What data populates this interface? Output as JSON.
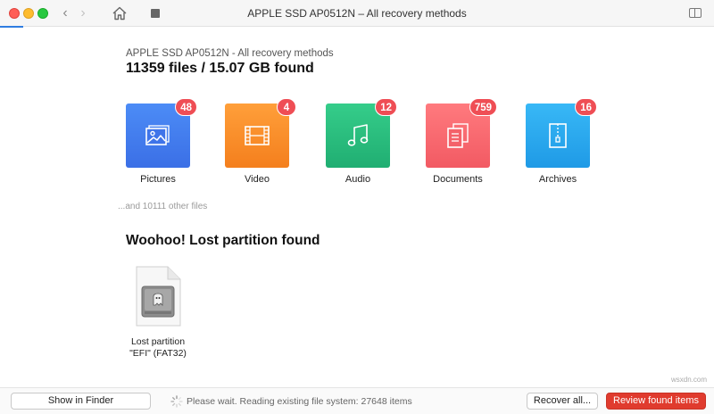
{
  "window": {
    "title": "APPLE SSD AP0512N – All recovery methods"
  },
  "header": {
    "drive_label": "APPLE SSD AP0512N - All recovery methods",
    "summary": "11359 files / 15.07 GB found"
  },
  "categories": [
    {
      "label": "Pictures",
      "count": "48",
      "icon": "picture-icon",
      "color": "#3b6fe6"
    },
    {
      "label": "Video",
      "count": "4",
      "icon": "film-icon",
      "color": "#f47f1d"
    },
    {
      "label": "Audio",
      "count": "12",
      "icon": "music-note-icon",
      "color": "#20ae72"
    },
    {
      "label": "Documents",
      "count": "759",
      "icon": "documents-icon",
      "color": "#f25a63"
    },
    {
      "label": "Archives",
      "count": "16",
      "icon": "archive-zipper-icon",
      "color": "#1f9ae6"
    }
  ],
  "other_files": "...and 10111 other files",
  "partition": {
    "heading": "Woohoo! Lost partition found",
    "name_line1": "Lost partition",
    "name_line2": "\"EFI\" (FAT32)"
  },
  "bottombar": {
    "show_in_finder": "Show in Finder",
    "status": "Please wait. Reading existing file system: 27648 items",
    "recover_all": "Recover all...",
    "review_found": "Review found items"
  },
  "watermark": "wsxdn.com",
  "colors": {
    "accent": "#2f7de1",
    "badge": "#ef4e55",
    "primary_button": "#e03b2e"
  }
}
